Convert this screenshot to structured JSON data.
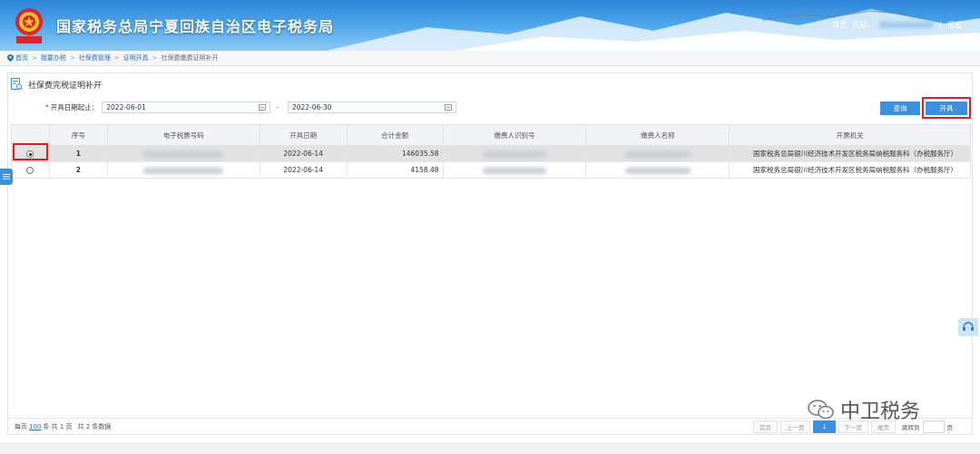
{
  "header": {
    "site_title": "国家税务总局宁夏回族自治区电子税务局",
    "links": [
      "首页",
      "欢迎，",
      "|",
      "退出"
    ]
  },
  "breadcrumb": [
    "首页",
    "我要办税",
    "社保费管理",
    "证明开具",
    "社保费缴费证明补开"
  ],
  "page": {
    "title": "社保费完税证明补开",
    "date_label": "开具日期起止：",
    "date_from": "2022-06-01",
    "date_sep": "-",
    "date_to": "2022-06-30",
    "query_button": "查询",
    "issue_button": "开具"
  },
  "table": {
    "headers": [
      "",
      "序号",
      "电子税票号码",
      "开具日期",
      "合计金额",
      "缴费人识别号",
      "缴费人名称",
      "开票机关"
    ],
    "rows": [
      {
        "selected": true,
        "no": "1",
        "date": "2022-06-14",
        "amount": "146035.58",
        "org": "国家税务总局银川经济技术开发区税务局纳税服务科（办税服务厅）"
      },
      {
        "selected": false,
        "no": "2",
        "date": "2022-06-14",
        "amount": "4158.48",
        "org": "国家税务总局银川经济技术开发区税务局纳税服务科（办税服务厅）"
      }
    ]
  },
  "footer": {
    "per_page_prefix": "每页",
    "per_page": "100",
    "per_page_suffix": "条 共 1 页",
    "total": "共 2 条数据"
  },
  "pager": {
    "first": "首页",
    "prev": "上一页",
    "current": "1",
    "next": "下一页",
    "last": "尾页",
    "jump": "跳转到",
    "page_unit": "页"
  },
  "watermark": "中卫税务",
  "colors": {
    "accent": "#3d8fe0",
    "highlight_border": "#e01f1f",
    "selected_row": "#e2e2e2"
  }
}
